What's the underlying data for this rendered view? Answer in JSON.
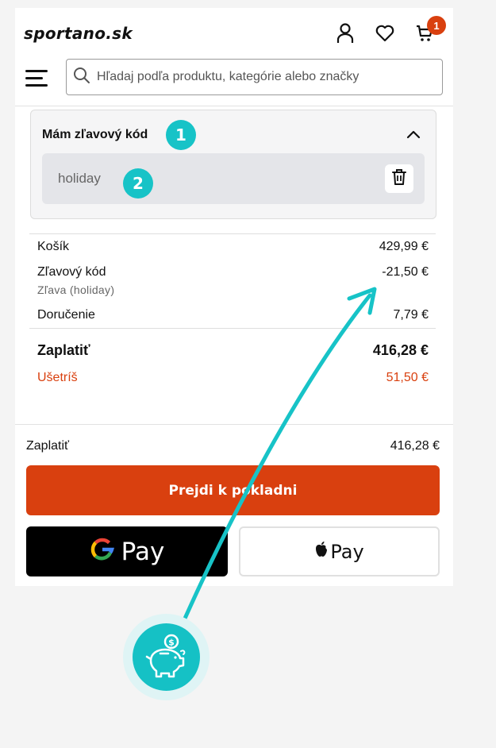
{
  "header": {
    "logo": "sportano.sk",
    "cart_count": "1",
    "search_placeholder": "Hľadaj podľa produktu, kategórie alebo značky"
  },
  "discount": {
    "title": "Mám zľavový kód",
    "code": "holiday",
    "step1": "1",
    "step2": "2"
  },
  "summary": {
    "cart_label": "Košík",
    "cart_value": "429,99 €",
    "code_label": "Zľavový kód",
    "code_value": "-21,50 €",
    "code_sub": "Zľava (holiday)",
    "delivery_label": "Doručenie",
    "delivery_value": "7,79 €",
    "total_label": "Zaplatiť",
    "total_value": "416,28 €",
    "save_label": "Ušetríš",
    "save_value": "51,50 €"
  },
  "checkout": {
    "pay_label": "Zaplatiť",
    "pay_value": "416,28 €",
    "button": "Prejdi k pokladni",
    "gpay_text": "Pay",
    "apay_text": "Pay"
  },
  "colors": {
    "accent": "#d9400f",
    "teal": "#17c3c7"
  },
  "icons": [
    "user-icon",
    "heart-icon",
    "cart-icon",
    "menu-icon",
    "search-icon",
    "chevron-up-icon",
    "trash-icon",
    "google-logo",
    "apple-logo",
    "piggy-bank-icon",
    "coin-icon"
  ]
}
